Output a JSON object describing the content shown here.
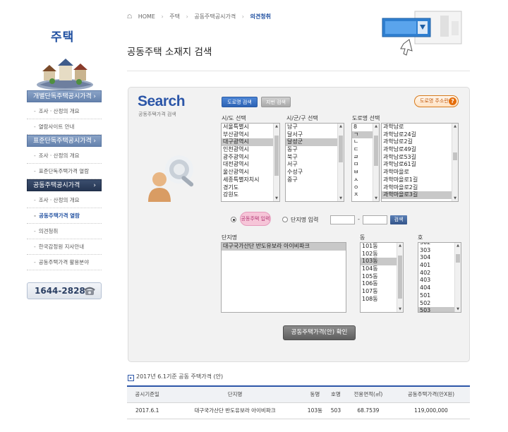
{
  "sidebar": {
    "title": "주택",
    "menu": [
      {
        "type": "head",
        "label": "개별단독주택공시가격",
        "active": false
      },
      {
        "type": "sub",
        "label": "조사 · 산정의 개요"
      },
      {
        "type": "sub",
        "label": "열람사이트 안내"
      },
      {
        "type": "head",
        "label": "표준단독주택공시가격",
        "active": false
      },
      {
        "type": "sub",
        "label": "조사 · 산정의 개요"
      },
      {
        "type": "sub",
        "label": "표준단독주택가격 열람"
      },
      {
        "type": "head",
        "label": "공동주택공시가격",
        "active": true
      },
      {
        "type": "sub",
        "label": "조사 · 산정의 개요"
      },
      {
        "type": "sub",
        "label": "공동주택가격 열람",
        "current": true
      },
      {
        "type": "sub",
        "label": "의견청취"
      },
      {
        "type": "sub",
        "label": "한국감정원 지사안내"
      },
      {
        "type": "sub",
        "label": "공동주택가격 활용분야"
      }
    ],
    "phone": "1644-2828"
  },
  "breadcrumb": {
    "home": "HOME",
    "level1": "주택",
    "level2": "공동주택공시가격",
    "current": "의견청취"
  },
  "page_title": "공동주택 소재지 검색",
  "search": {
    "logo": "Search",
    "subtitle": "공동주택가격 검색",
    "tab_road": "도로명 검색",
    "tab_lot": "지번 검색",
    "road_help": "도로명 주소란",
    "sido_label": "시/도 선택",
    "sido_options": [
      "서울특별시",
      "부산광역시",
      "대구광역시",
      "인천광역시",
      "광주광역시",
      "대전광역시",
      "울산광역시",
      "세종특별자치시",
      "경기도",
      "강원도"
    ],
    "sido_selected": 2,
    "sigungu_label": "시/군/구 선택",
    "sigungu_options": [
      "남구",
      "달서구",
      "달성군",
      "동구",
      "북구",
      "서구",
      "수성구",
      "중구"
    ],
    "sigungu_selected": 2,
    "road_label": "도로명 선택",
    "road_initials": [
      "8",
      "ㄱ",
      "ㄴ",
      "ㄷ",
      "ㄹ",
      "ㅁ",
      "ㅂ",
      "ㅅ",
      "ㅇ",
      "ㅈ"
    ],
    "road_initial_selected": 1,
    "road_names": [
      "과학남로",
      "과학남로24길",
      "과학남로2길",
      "과학남로49길",
      "과학남로53길",
      "과학남로61길",
      "과학마을로",
      "과학마을로1길",
      "과학마을로2길",
      "과학마을로3길"
    ],
    "road_name_selected": 9,
    "radio_apt_label": "공동주택 입력",
    "radio_danji_label": "단지명 입력",
    "num_dash": "-",
    "num_search_btn": "검색",
    "danji_label": "단지명",
    "danji_options": [
      "대구국가산단 반도유보라 아이비파크"
    ],
    "danji_selected": 0,
    "dong_label": "동",
    "dong_options": [
      "101동",
      "102동",
      "103동",
      "104동",
      "105동",
      "106동",
      "107동",
      "108동"
    ],
    "dong_selected": 2,
    "ho_label": "호",
    "ho_options": [
      "302",
      "303",
      "304",
      "401",
      "402",
      "403",
      "404",
      "501",
      "502",
      "503"
    ],
    "ho_selected": 9,
    "confirm_btn": "공동주택가격(안) 확인"
  },
  "result": {
    "title": "2017년 6.1기준 공동 주택가격 (안)",
    "columns": [
      "공시기준일",
      "단지명",
      "동명",
      "호명",
      "전용면적(㎡)",
      "공동주택가격(만X원)"
    ],
    "rows": [
      [
        "2017.6.1",
        "대구국가산단 반도유보라 아이비파크",
        "103동",
        "503",
        "68.7539",
        "119,000,000"
      ]
    ]
  },
  "colors": {
    "accent": "#2c56a8",
    "menu_active": "#253552",
    "menu": "#6582ad",
    "orange": "#e46c0a"
  },
  "icons": [
    "home-icon",
    "house-illustration",
    "phone-icon",
    "search-illustration",
    "person-illustration",
    "help-icon"
  ]
}
